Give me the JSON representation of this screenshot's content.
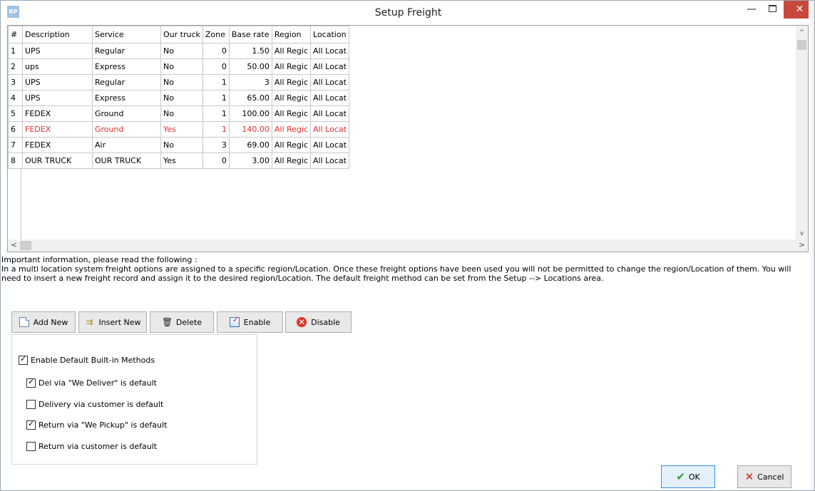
{
  "window": {
    "app_icon": "RP",
    "title": "Setup Freight",
    "minimize_glyph": "—",
    "close_glyph": "✕"
  },
  "grid": {
    "columns": [
      "#",
      "Description",
      "Service",
      "Our truck",
      "Zone",
      "Base rate",
      "Region",
      "Location"
    ],
    "rows": [
      [
        "1",
        "UPS",
        "Regular",
        "No",
        "0",
        "1.50",
        "All Regic",
        "All Locat"
      ],
      [
        "2",
        "ups",
        "Express",
        "No",
        "0",
        "50.00",
        "All Regic",
        "All Locat"
      ],
      [
        "3",
        "UPS",
        "Regular",
        "No",
        "1",
        "3",
        "All Regic",
        "All Locat"
      ],
      [
        "4",
        "UPS",
        "Express",
        "No",
        "1",
        "65.00",
        "All Regic",
        "All Locat"
      ],
      [
        "5",
        "FEDEX",
        "Ground",
        "No",
        "1",
        "100.00",
        "All Regic",
        "All Locat"
      ],
      [
        "6",
        "FEDEX",
        "Ground",
        "Yes",
        "1",
        "140.00",
        "All Regic",
        "All Locat"
      ],
      [
        "7",
        "FEDEX",
        "Air",
        "No",
        "3",
        "69.00",
        "All Regic",
        "All Locat"
      ],
      [
        "8",
        "OUR TRUCK",
        "OUR TRUCK",
        "Yes",
        "0",
        "3.00",
        "All Regic",
        "All Locat"
      ]
    ],
    "highlight_row_color": "#e03030",
    "scroll_up": "^",
    "scroll_down": "v",
    "scroll_left": "<",
    "scroll_right": ">"
  },
  "info": {
    "heading": "Important information, please read the following :",
    "body": "In a multi location system freight options are assigned to a specific region/Location. Once these freight options have been used you will not be permitted to change the region/Location of them. You will need to insert a new freight record and assign it to the desired region/Location. The default freight method can be set from the Setup --> Locations area."
  },
  "toolbar": {
    "add_new": "Add New",
    "insert_new": "Insert New",
    "delete": "Delete",
    "enable": "Enable",
    "disable": "Disable"
  },
  "options": {
    "enable_default": {
      "label": "Enable Default Built-in Methods",
      "checked": true
    },
    "del_we_deliver": {
      "label": "Del via \"We Deliver\" is default",
      "checked": true
    },
    "delivery_customer": {
      "label": "Delivery via customer is default",
      "checked": false
    },
    "return_we_pickup": {
      "label": "Return via \"We Pickup\" is default",
      "checked": true
    },
    "return_customer": {
      "label": "Return via customer is default",
      "checked": false
    }
  },
  "dialog": {
    "ok": "OK",
    "cancel": "Cancel"
  }
}
